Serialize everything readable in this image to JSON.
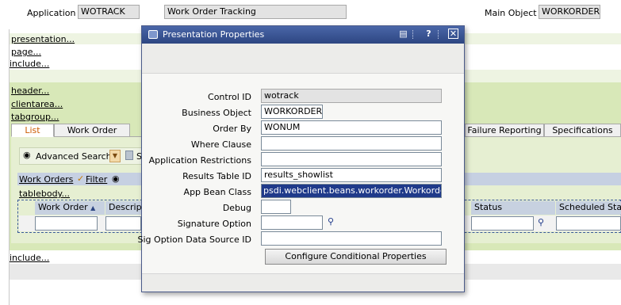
{
  "header": {
    "application_label": "Application",
    "application_value": "WOTRACK",
    "description_value": "Work Order Tracking",
    "main_object_label": "Main Object",
    "main_object_value": "WORKORDER"
  },
  "tree": {
    "presentation": "presentation...",
    "page": "page...",
    "include_top": "include...",
    "header": "header...",
    "clientarea": "clientarea...",
    "tabgroup": "tabgroup...",
    "tablebody": "tablebody...",
    "include_bottom": "include..."
  },
  "tabs": [
    "List",
    "Work Order",
    "Failure Reporting",
    "Specifications"
  ],
  "toolbar": {
    "advanced_search": "Advanced Search",
    "save_partial": "S"
  },
  "table": {
    "title": "Work Orders",
    "filter": "Filter",
    "columns": [
      "Work Order",
      "Descripti",
      "Status",
      "Scheduled Start"
    ]
  },
  "dialog": {
    "title": "Presentation Properties",
    "fields": [
      {
        "label": "Control ID",
        "value": "wotrack"
      },
      {
        "label": "Business Object",
        "value": "WORKORDER"
      },
      {
        "label": "Order By",
        "value": "WONUM"
      },
      {
        "label": "Where Clause",
        "value": ""
      },
      {
        "label": "Application Restrictions",
        "value": ""
      },
      {
        "label": "Results Table ID",
        "value": "results_showlist"
      },
      {
        "label": "App Bean Class",
        "value": "psdi.webclient.beans.workorder.WorkorderAp"
      },
      {
        "label": "Debug",
        "value": ""
      },
      {
        "label": "Signature Option",
        "value": ""
      },
      {
        "label": "Sig Option Data Source ID",
        "value": ""
      }
    ],
    "configure_button": "Configure Conditional Properties"
  },
  "colors": {
    "title_bar": "#2d4682",
    "green_band": "#d8e8b8",
    "active_tab_text": "#cc5a00",
    "selection": "#1f3a8a"
  }
}
